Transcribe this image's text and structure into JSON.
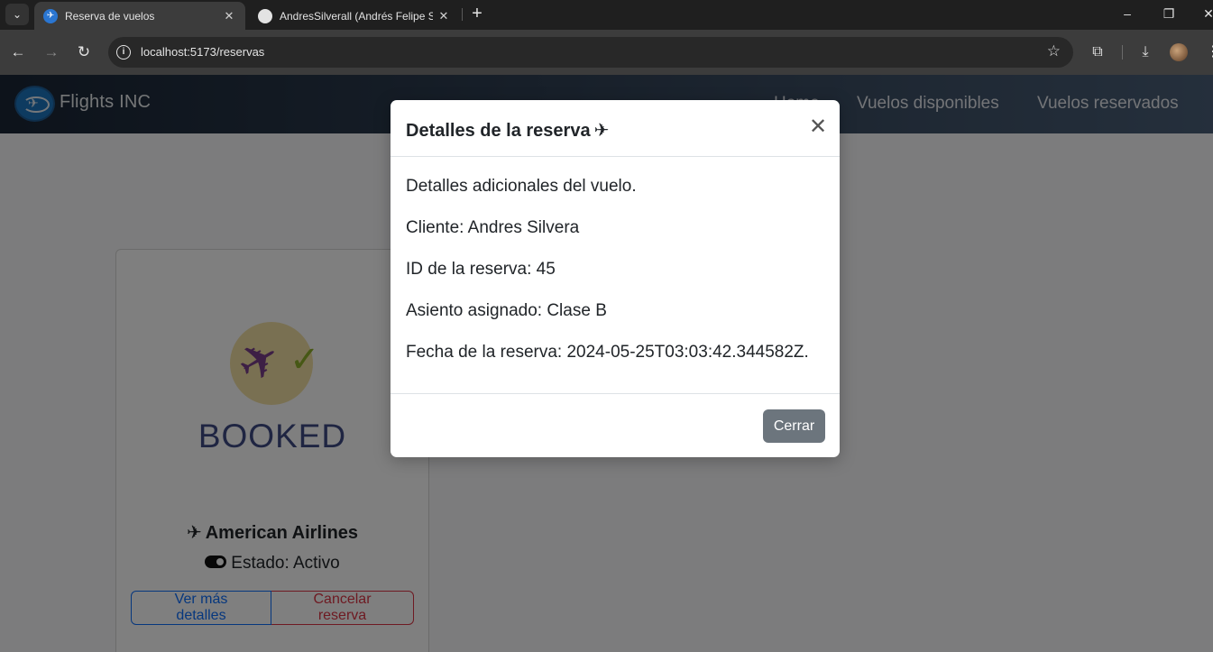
{
  "browser": {
    "tabs": [
      {
        "title": "Reserva de vuelos",
        "active": true
      },
      {
        "title": "AndresSilverall (Andrés Felipe S",
        "active": false
      }
    ],
    "url": "localhost:5173/reservas"
  },
  "navbar": {
    "brand": "Flights INC",
    "links": [
      "Home",
      "Vuelos disponibles",
      "Vuelos reservados"
    ]
  },
  "card": {
    "image_text": "BOOKED",
    "airline": "American Airlines",
    "status": "Estado: Activo",
    "details_button": "Ver más detalles",
    "cancel_button": "Cancelar reserva"
  },
  "modal": {
    "title": "Detalles de la reserva",
    "lines": [
      "Detalles adicionales del vuelo.",
      "Cliente: Andres Silvera",
      "ID de la reserva: 45",
      "Asiento asignado: Clase B",
      "Fecha de la reserva: 2024-05-25T03:03:42.344582Z."
    ],
    "close_button": "Cerrar"
  },
  "colors": {
    "primary": "#0d6efd",
    "danger": "#dc3545",
    "secondary": "#6c757d",
    "navbar_start": "#1a2636",
    "navbar_end": "#4a5f78"
  }
}
